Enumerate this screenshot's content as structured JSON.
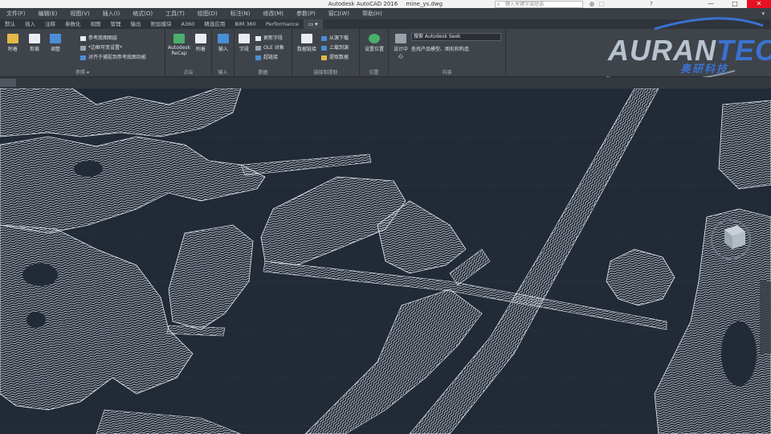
{
  "titlebar": {
    "app_name": "Autodesk AutoCAD 2016",
    "file_name": "mine_ys.dwg",
    "search_placeholder": "键入关键字或短语",
    "icons": [
      "user-icon",
      "exchange-icon",
      "help-icon"
    ],
    "window_controls": [
      "minimize-icon",
      "maximize-icon",
      "close-icon"
    ]
  },
  "menubar": {
    "items": [
      "文件(F)",
      "编辑(E)",
      "视图(V)",
      "插入(I)",
      "格式(O)",
      "工具(T)",
      "绘图(D)",
      "标注(N)",
      "修改(M)",
      "参数(P)",
      "窗口(W)",
      "帮助(H)"
    ],
    "right": "▾"
  },
  "ribbon_tabs": {
    "items": [
      "默认",
      "插入",
      "注释",
      "参数化",
      "视图",
      "管理",
      "输出",
      "附加模块",
      "A360",
      "精选应用",
      "BIM 360",
      "Performance",
      "▭ ▾"
    ],
    "active_index": 12
  },
  "ribbon": {
    "panels": [
      {
        "label": "参照 ▾",
        "buttons": [
          "附着",
          "剪裁",
          "调整"
        ],
        "rows": [
          "参考底图图层",
          "*边框可变设置*",
          "对齐于捕捉到参考底图功能"
        ]
      },
      {
        "label": "点云",
        "buttons": [
          "Autodesk ReCap",
          "附着"
        ]
      },
      {
        "label": "输入",
        "buttons": [
          "输入"
        ]
      },
      {
        "label": "数据",
        "buttons": [
          "字段"
        ],
        "rows": [
          "更新字段",
          "OLE 对象",
          "超链接"
        ]
      },
      {
        "label": "链接和提取",
        "buttons": [
          "数据链接"
        ],
        "rows": [
          "从源下载",
          "上载到源",
          "提取数据"
        ]
      },
      {
        "label": "位置",
        "buttons": [
          "设置位置"
        ]
      },
      {
        "label": "内容",
        "buttons": [
          "设计中心"
        ],
        "rows": [
          "搜索 Autodesk Seek",
          "查找产品模型、图形和构造"
        ]
      }
    ]
  },
  "logo": {
    "brand_main": "AURAN",
    "brand_accent": "TECH",
    "brand_cn": "奥研科技"
  },
  "colors": {
    "viewport_bg": "#222a36",
    "wire": "#e6ebf0",
    "accent": "#3a72d0"
  }
}
